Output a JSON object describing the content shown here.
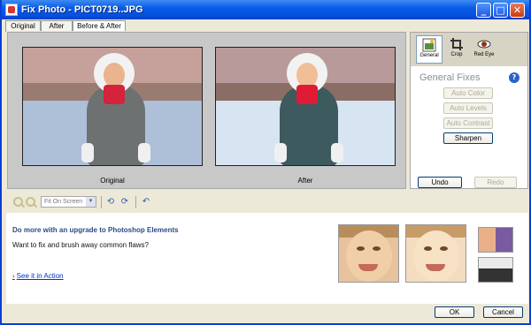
{
  "window": {
    "title": "Fix Photo - PICT0719..JPG"
  },
  "tabs": [
    {
      "label": "Original"
    },
    {
      "label": "After"
    },
    {
      "label": "Before & After"
    }
  ],
  "preview": {
    "left_caption": "Original",
    "right_caption": "After"
  },
  "tools": [
    {
      "label": "General",
      "icon": "general-icon"
    },
    {
      "label": "Crop",
      "icon": "crop-icon"
    },
    {
      "label": "Red Eye",
      "icon": "red-eye-icon"
    }
  ],
  "fixes": {
    "title": "General Fixes",
    "auto_color": "Auto Color",
    "auto_levels": "Auto Levels",
    "auto_contrast": "Auto Contrast",
    "sharpen": "Sharpen",
    "undo": "Undo",
    "redo": "Redo"
  },
  "toolbar": {
    "zoom": "Fit On Screen"
  },
  "promo": {
    "title": "Do more with an upgrade to Photoshop Elements",
    "subtitle": "Want to fix and brush away common flaws?",
    "link": "See it in Action"
  },
  "footer": {
    "ok": "OK",
    "cancel": "Cancel"
  },
  "colors": {
    "title_bar": "#0a5ce8",
    "link": "#0033cc",
    "promo_title": "#2b4b86"
  }
}
